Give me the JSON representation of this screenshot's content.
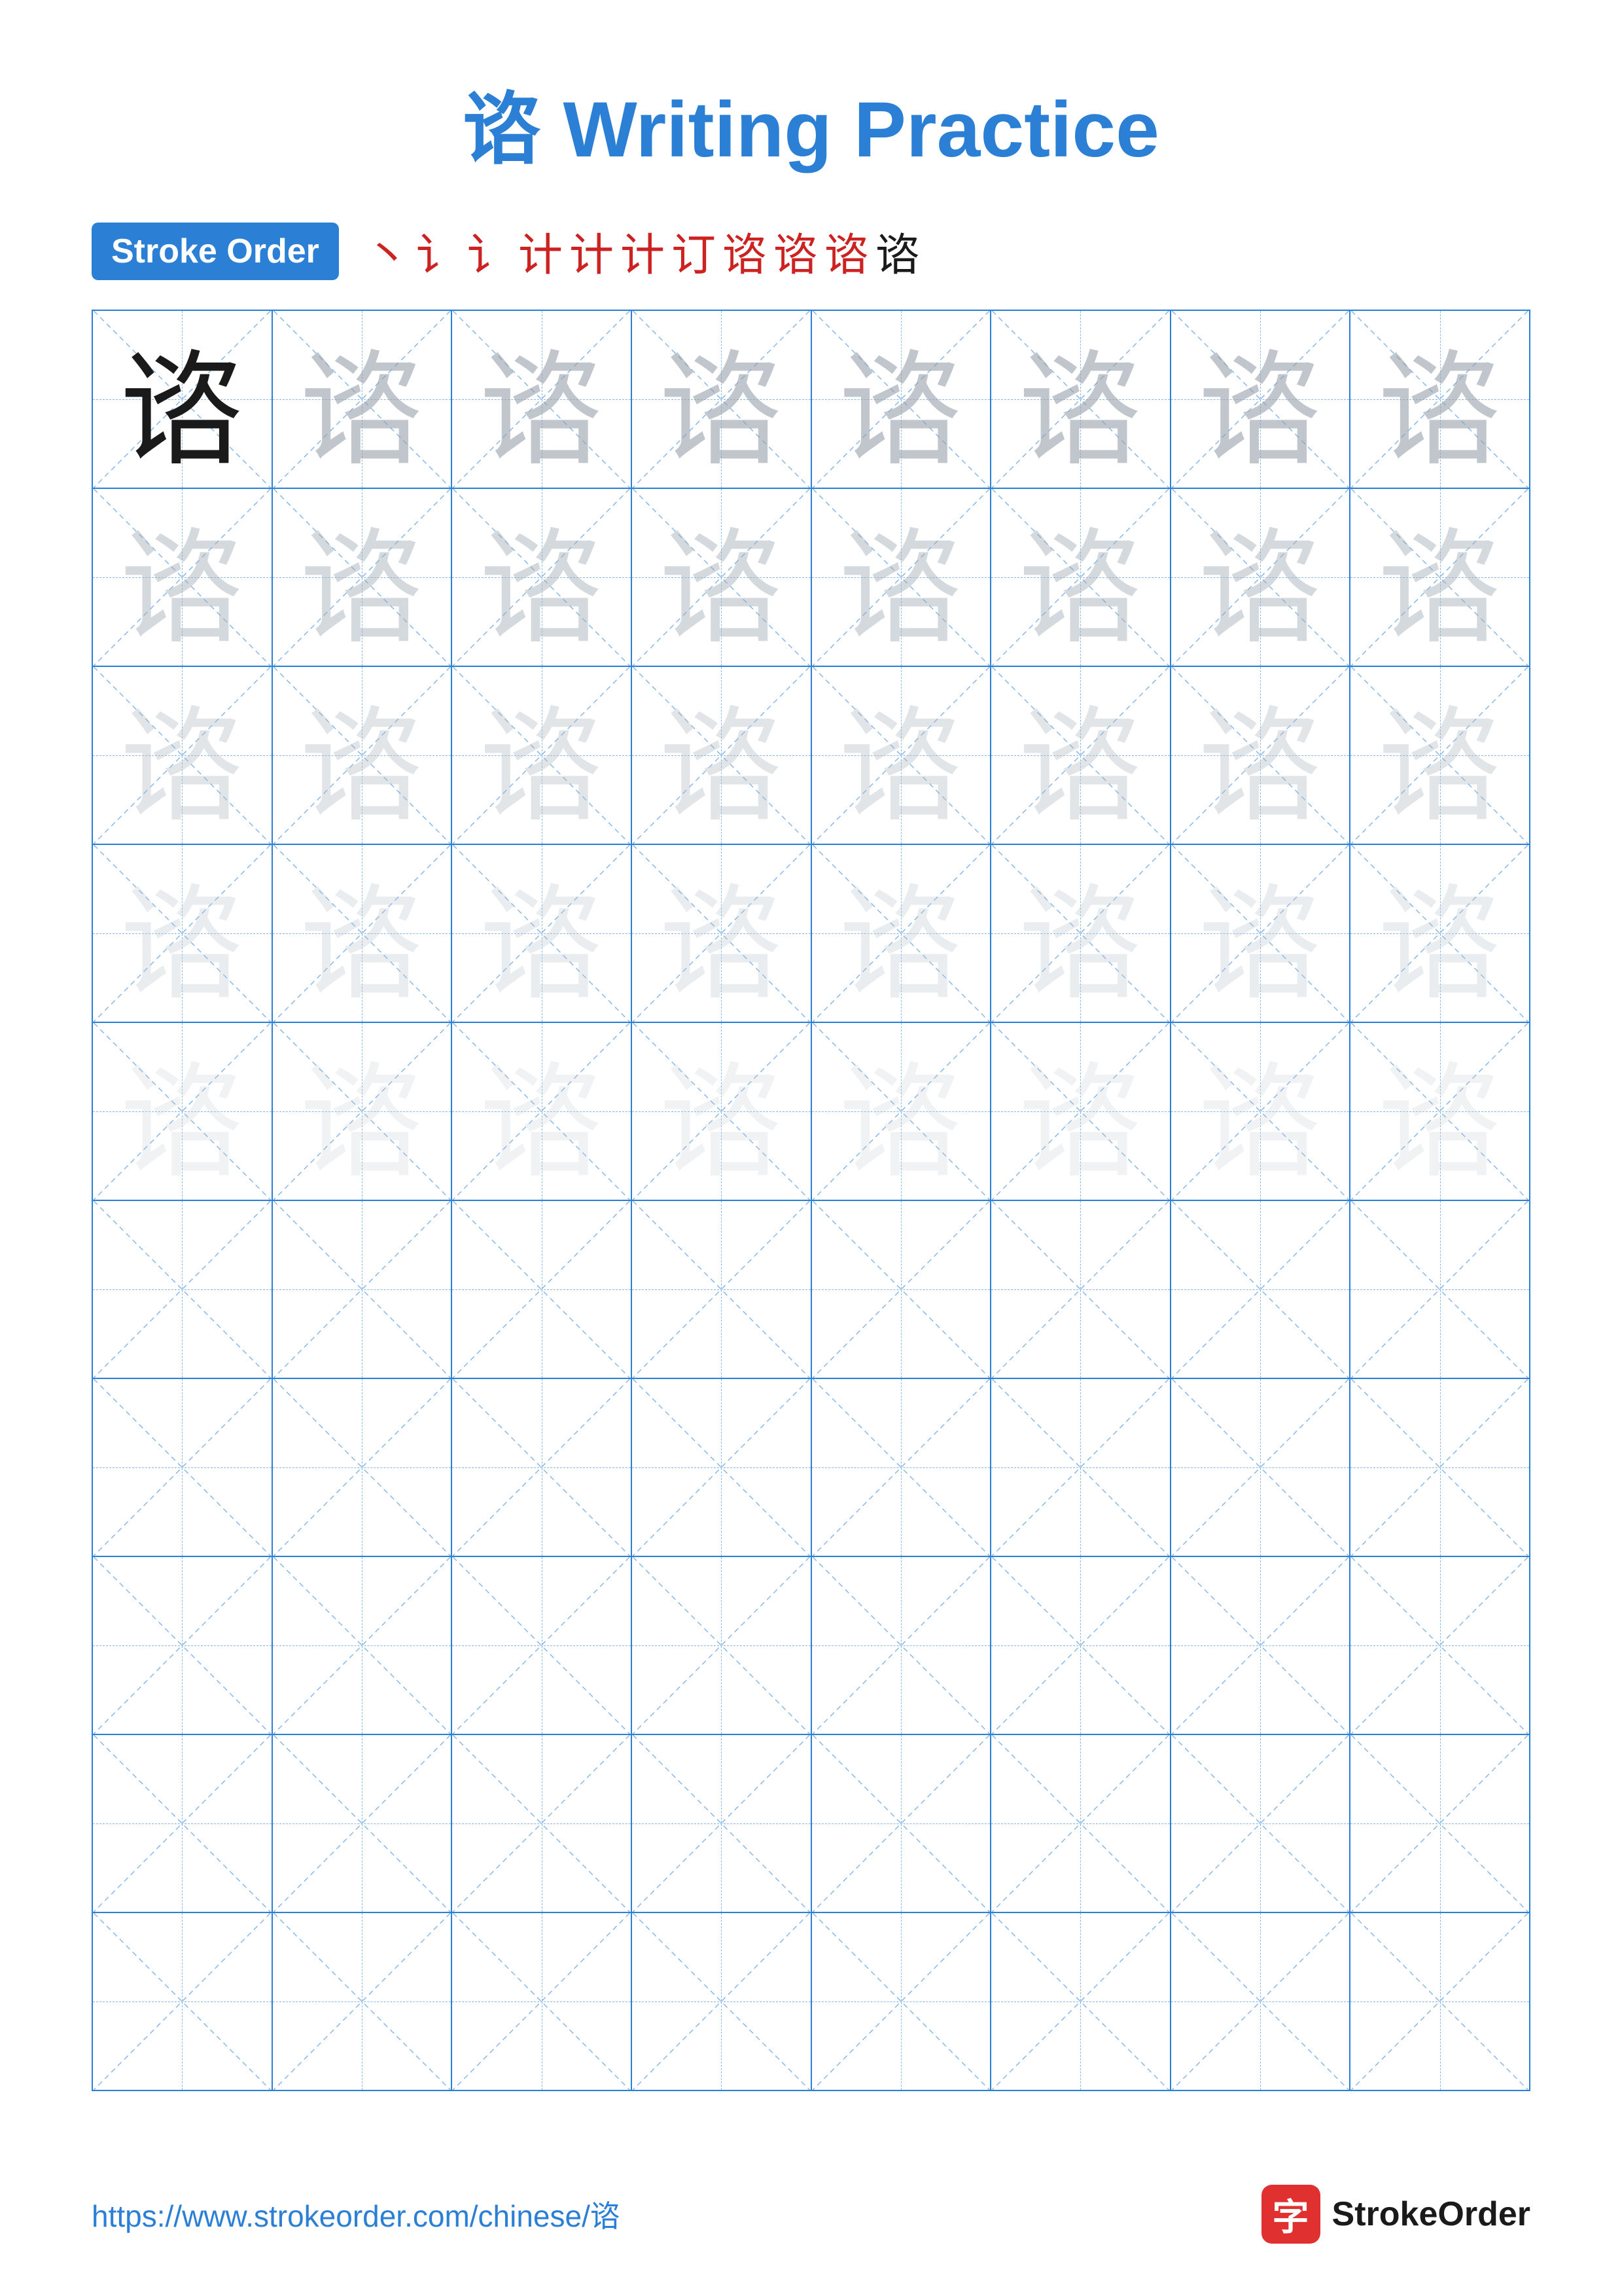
{
  "page": {
    "title_char": "谘",
    "title_text": " Writing Practice",
    "title_color": "#2b7fd4"
  },
  "stroke_order": {
    "badge_label": "Stroke Order",
    "strokes": [
      "丶",
      "讠",
      "讠",
      "讠̀",
      "讠̈",
      "讠̈",
      "讠̈",
      "计",
      "订",
      "谘",
      "谘"
    ]
  },
  "grid": {
    "char": "谘",
    "rows": 10,
    "cols": 8,
    "filled_rows": 5,
    "empty_rows": 5
  },
  "footer": {
    "url": "https://www.strokeorder.com/chinese/谘",
    "logo_char": "字",
    "logo_name": "StrokeOrder"
  }
}
